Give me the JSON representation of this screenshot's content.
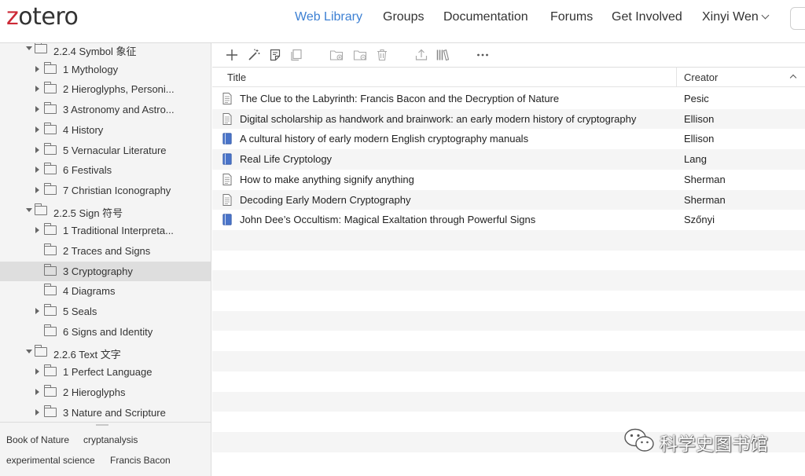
{
  "header": {
    "logo": "zotero",
    "nav": [
      {
        "label": "Web Library",
        "active": true
      },
      {
        "label": "Groups"
      },
      {
        "label": "Documentation"
      },
      {
        "label": "Forums"
      },
      {
        "label": "Get Involved"
      }
    ],
    "user": "Xinyi Wen"
  },
  "tree": [
    {
      "label": "2.2.4 Symbol 象征",
      "level": 0,
      "expanded": true
    },
    {
      "label": "1 Mythology",
      "level": 1,
      "has_children": true
    },
    {
      "label": "2 Hieroglyphs, Personi...",
      "level": 1,
      "has_children": true
    },
    {
      "label": "3 Astronomy and Astro...",
      "level": 1,
      "has_children": true
    },
    {
      "label": "4 History",
      "level": 1,
      "has_children": true
    },
    {
      "label": "5 Vernacular Literature",
      "level": 1,
      "has_children": true
    },
    {
      "label": "6 Festivals",
      "level": 1,
      "has_children": true
    },
    {
      "label": "7 Christian Iconography",
      "level": 1,
      "has_children": true
    },
    {
      "label": "2.2.5 Sign 符号",
      "level": 0,
      "expanded": true
    },
    {
      "label": "1 Traditional Interpreta...",
      "level": 1,
      "has_children": true
    },
    {
      "label": "2 Traces and Signs",
      "level": 1,
      "has_children": false
    },
    {
      "label": "3 Cryptography",
      "level": 1,
      "has_children": false,
      "selected": true
    },
    {
      "label": "4 Diagrams",
      "level": 1,
      "has_children": false
    },
    {
      "label": "5 Seals",
      "level": 1,
      "has_children": true
    },
    {
      "label": "6 Signs and Identity",
      "level": 1,
      "has_children": false
    },
    {
      "label": "2.2.6 Text 文字",
      "level": 0,
      "expanded": true
    },
    {
      "label": "1 Perfect Language",
      "level": 1,
      "has_children": true
    },
    {
      "label": "2 Hieroglyphs",
      "level": 1,
      "has_children": true
    },
    {
      "label": "3 Nature and Scripture",
      "level": 1,
      "has_children": true
    }
  ],
  "tags": [
    "Book of Nature",
    "cryptanalysis",
    "experimental science",
    "Francis Bacon"
  ],
  "toolbar": [
    "add-icon",
    "magic-wand-icon",
    "new-note-icon",
    "duplicate-icon",
    "add-to-collection-icon",
    "remove-from-collection-icon",
    "trash-icon",
    "export-icon",
    "library-icon",
    "more-icon"
  ],
  "table": {
    "columns": {
      "title": "Title",
      "creator": "Creator"
    },
    "rows": [
      {
        "title": "The Clue to the Labyrinth: Francis Bacon and the Decryption of Nature",
        "creator": "Pesic",
        "type": "document"
      },
      {
        "title": "Digital scholarship as handwork and brainwork: an early modern history of cryptography",
        "creator": "Ellison",
        "type": "document"
      },
      {
        "title": "A cultural history of early modern English cryptography manuals",
        "creator": "Ellison",
        "type": "book"
      },
      {
        "title": "Real Life Cryptology",
        "creator": "Lang",
        "type": "book"
      },
      {
        "title": "How to make anything signify anything",
        "creator": "Sherman",
        "type": "document"
      },
      {
        "title": "Decoding Early Modern Cryptography",
        "creator": "Sherman",
        "type": "document"
      },
      {
        "title": "John Dee’s Occultism: Magical Exaltation through Powerful Signs",
        "creator": "Szőnyi",
        "type": "book"
      }
    ]
  },
  "watermark": "科学史图书馆",
  "colors": {
    "accent": "#3d80d3",
    "logo_z": "#cc2936",
    "book_icon": "#4a74c9"
  }
}
